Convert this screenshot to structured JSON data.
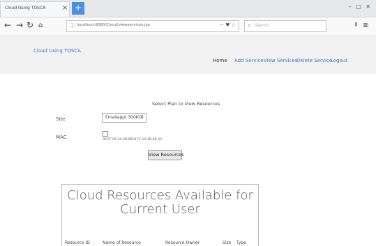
{
  "browser": {
    "tab_title": "Cloud Using TOSCA",
    "tab_close": "×",
    "new_tab": "+",
    "url": "localhost:8080/Cloud/viewservices.jsp",
    "search_placeholder": "Search"
  },
  "header": {
    "brand": "Cloud Using TOSCA",
    "menu": [
      "Home",
      "Add Service",
      "View Services",
      "Delete Service",
      "Logout"
    ]
  },
  "form": {
    "title": "Select Plan to View Resources",
    "site_label": "Site",
    "site_value": "Emailappt 30(40)",
    "mac_label": "MAC",
    "mac_value": "00-FF-0A-3A-4B-00C0 FF-1A-3B-4B-3A",
    "button": "View Resources"
  },
  "resources": {
    "title": "Cloud Resources Available for Current User",
    "columns": [
      "Resource ID",
      "Name of Resource",
      "Resource Owner",
      "Size",
      "Type"
    ]
  }
}
